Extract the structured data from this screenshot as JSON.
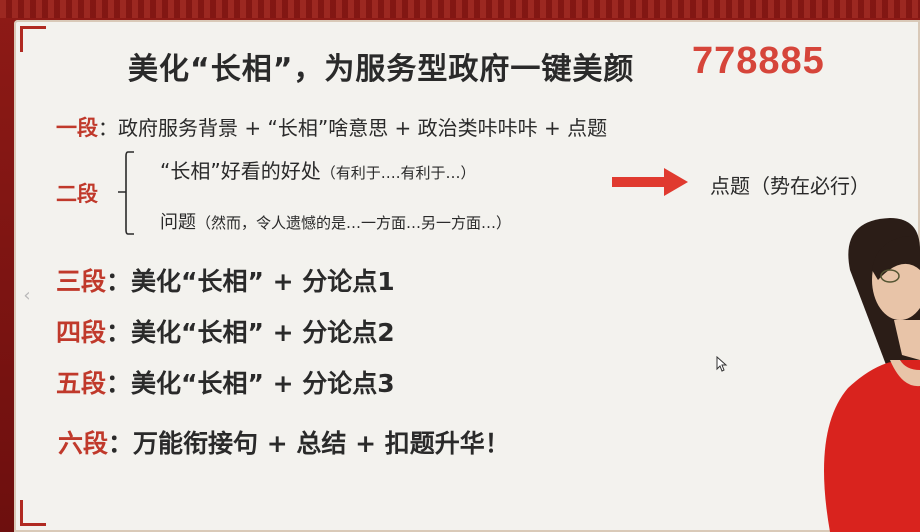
{
  "slide": {
    "title": "美化“长相”，为服务型政府一键美颜",
    "title_number": "778885",
    "segment1": {
      "label": "一段",
      "content": "：政府服务背景 + “长相”啥意思 + 政治类咔咔咔 + 点题"
    },
    "segment2": {
      "label": "二段",
      "sub1_main": "“长相”好看的好处",
      "sub1_note": "（有利于….有利于…）",
      "sub2_main": "问题",
      "sub2_note": "（然而，令人遗憾的是…一方面…另一方面…）",
      "result": "点题（势在必行）"
    },
    "segment3": {
      "label": "三段",
      "content": "：美化“长相” + 分论点1"
    },
    "segment4": {
      "label": "四段",
      "content": "：美化“长相” + 分论点2"
    },
    "segment5": {
      "label": "五段",
      "content": "：美化“长相” + 分论点3"
    },
    "segment6": {
      "label": "六段",
      "content": "：万能衔接句 + 总结 + 扣题升华！"
    }
  },
  "colors": {
    "frame": "#7a1212",
    "accent_red": "#c0392b",
    "number_red": "#d6453a",
    "arrow_red": "#e03a2f",
    "text": "#2a2a2a",
    "board": "#f3f2ee"
  },
  "icons": {
    "nav": "chevron-left-icon",
    "arrow": "arrow-right-icon",
    "cursor": "mouse-cursor-icon"
  }
}
